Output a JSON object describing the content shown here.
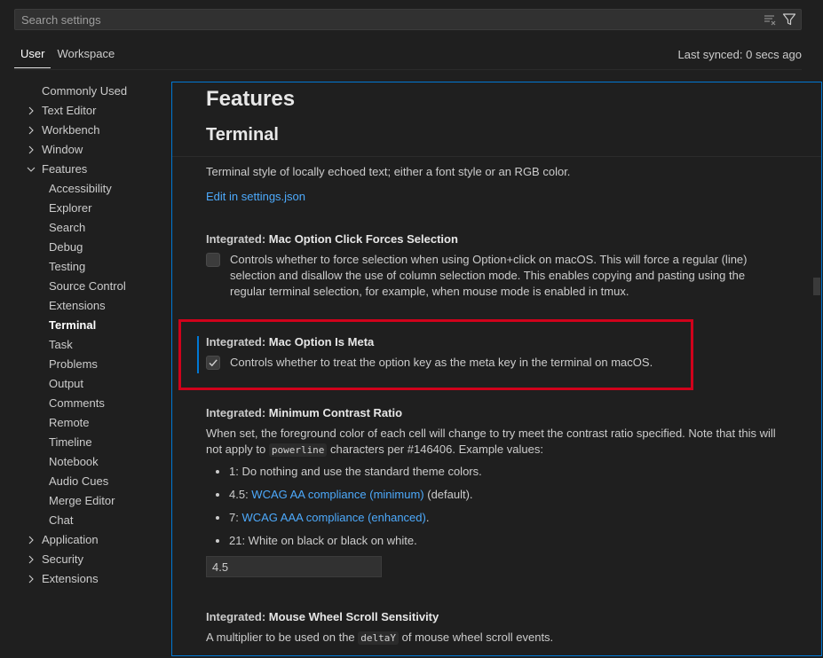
{
  "search": {
    "placeholder": "Search settings",
    "icons": [
      "clear-filter-icon",
      "filter-icon"
    ]
  },
  "tabs": [
    {
      "label": "User",
      "active": true
    },
    {
      "label": "Workspace",
      "active": false
    }
  ],
  "last_synced": "Last synced: 0 secs ago",
  "toc": [
    {
      "label": "Commonly Used",
      "level": "top",
      "chevron": "none"
    },
    {
      "label": "Text Editor",
      "level": "top",
      "chevron": "right"
    },
    {
      "label": "Workbench",
      "level": "top",
      "chevron": "right"
    },
    {
      "label": "Window",
      "level": "top",
      "chevron": "right"
    },
    {
      "label": "Features",
      "level": "top",
      "chevron": "down"
    },
    {
      "label": "Accessibility",
      "level": "sub"
    },
    {
      "label": "Explorer",
      "level": "sub"
    },
    {
      "label": "Search",
      "level": "sub"
    },
    {
      "label": "Debug",
      "level": "sub"
    },
    {
      "label": "Testing",
      "level": "sub"
    },
    {
      "label": "Source Control",
      "level": "sub"
    },
    {
      "label": "Extensions",
      "level": "sub"
    },
    {
      "label": "Terminal",
      "level": "sub",
      "active": true
    },
    {
      "label": "Task",
      "level": "sub"
    },
    {
      "label": "Problems",
      "level": "sub"
    },
    {
      "label": "Output",
      "level": "sub"
    },
    {
      "label": "Comments",
      "level": "sub"
    },
    {
      "label": "Remote",
      "level": "sub"
    },
    {
      "label": "Timeline",
      "level": "sub"
    },
    {
      "label": "Notebook",
      "level": "sub"
    },
    {
      "label": "Audio Cues",
      "level": "sub"
    },
    {
      "label": "Merge Editor",
      "level": "sub"
    },
    {
      "label": "Chat",
      "level": "sub"
    },
    {
      "label": "Application",
      "level": "top",
      "chevron": "right"
    },
    {
      "label": "Security",
      "level": "top",
      "chevron": "right"
    },
    {
      "label": "Extensions",
      "level": "top",
      "chevron": "right"
    }
  ],
  "editor": {
    "heading_features": "Features",
    "heading_terminal": "Terminal",
    "local_echo_style": {
      "description": "Terminal style of locally echoed text; either a font style or an RGB color.",
      "edit_link": "Edit in settings.json"
    },
    "mac_option_click": {
      "category": "Integrated: ",
      "name": "Mac Option Click Forces Selection",
      "checked": false,
      "description": "Controls whether to force selection when using Option+click on macOS. This will force a regular (line) selection and disallow the use of column selection mode. This enables copying and pasting using the regular terminal selection, for example, when mouse mode is enabled in tmux."
    },
    "mac_option_meta": {
      "category": "Integrated: ",
      "name": "Mac Option Is Meta",
      "checked": true,
      "description": "Controls whether to treat the option key as the meta key in the terminal on macOS."
    },
    "min_contrast": {
      "category": "Integrated: ",
      "name": "Minimum Contrast Ratio",
      "desc_part1": "When set, the foreground color of each cell will change to try meet the contrast ratio specified. Note that this will not apply to ",
      "desc_code": "powerline",
      "desc_part2": " characters per #146406. Example values:",
      "list": [
        {
          "pre": "1: Do nothing and use the standard theme colors.",
          "link": "",
          "post": ""
        },
        {
          "pre": "4.5: ",
          "link": "WCAG AA compliance (minimum)",
          "post": " (default)."
        },
        {
          "pre": "7: ",
          "link": "WCAG AAA compliance (enhanced)",
          "post": "."
        },
        {
          "pre": "21: White on black or black on white.",
          "link": "",
          "post": ""
        }
      ],
      "value": "4.5"
    },
    "mouse_wheel": {
      "category": "Integrated: ",
      "name": "Mouse Wheel Scroll Sensitivity",
      "desc_part1": "A multiplier to be used on the ",
      "desc_code": "deltaY",
      "desc_part2": " of mouse wheel scroll events."
    }
  },
  "colors": {
    "accent": "#0078d4",
    "link": "#4daafc",
    "highlight": "#d0021b",
    "background": "#1f1f1f"
  }
}
